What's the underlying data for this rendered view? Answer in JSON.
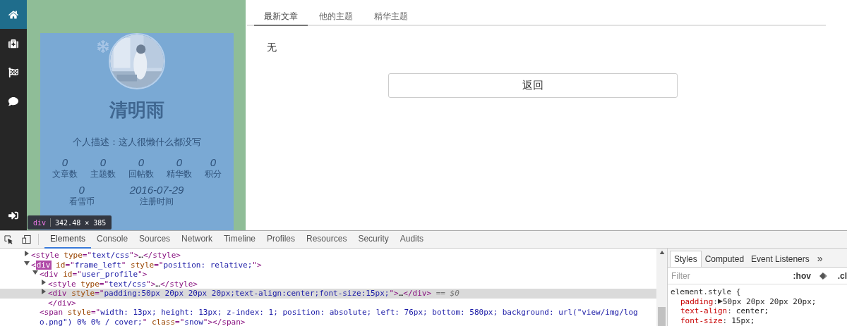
{
  "sidebar": {
    "items": [
      {
        "selected": true
      },
      {
        "selected": false
      },
      {
        "selected": false
      },
      {
        "selected": false
      }
    ]
  },
  "profile": {
    "name": "清明雨",
    "description": "个人描述：这人很懒什么都没写",
    "stats": [
      {
        "value": "0",
        "label": "文章数"
      },
      {
        "value": "0",
        "label": "主题数"
      },
      {
        "value": "0",
        "label": "回帖数"
      },
      {
        "value": "0",
        "label": "精华数"
      },
      {
        "value": "0",
        "label": "积分"
      }
    ],
    "stats_2": [
      {
        "value": "0",
        "label": "看雪币"
      },
      {
        "value": "2016-07-29",
        "label": "注册时间"
      }
    ]
  },
  "inspect_tooltip": {
    "tag": "div",
    "size": "342.48 × 385"
  },
  "main": {
    "tabs": [
      {
        "label": "最新文章",
        "selected": true
      },
      {
        "label": "他的主题",
        "selected": false
      },
      {
        "label": "精华主题",
        "selected": false
      }
    ],
    "empty_text": "无",
    "back_button": "返回"
  },
  "devtools": {
    "tabs": [
      {
        "label": "Elements",
        "selected": true
      },
      {
        "label": "Console",
        "selected": false
      },
      {
        "label": "Sources",
        "selected": false
      },
      {
        "label": "Network",
        "selected": false
      },
      {
        "label": "Timeline",
        "selected": false
      },
      {
        "label": "Profiles",
        "selected": false
      },
      {
        "label": "Resources",
        "selected": false
      },
      {
        "label": "Security",
        "selected": false
      },
      {
        "label": "Audits",
        "selected": false
      }
    ],
    "dom_tree": [
      {
        "expanded": false,
        "selected": false,
        "tokens": [
          {
            "kind": "tag",
            "text": "<style "
          },
          {
            "kind": "attr",
            "text": "type"
          },
          {
            "kind": "tag",
            "text": "=\""
          },
          {
            "kind": "value",
            "text": "text/css"
          },
          {
            "kind": "tag",
            "text": "\">"
          },
          {
            "kind": "plain",
            "text": "…"
          },
          {
            "kind": "tag",
            "text": "</style>"
          }
        ]
      },
      {
        "expanded": true,
        "selected": false,
        "tokens": [
          {
            "kind": "tag",
            "text": "<"
          },
          {
            "kind": "match",
            "text": "div"
          },
          {
            "kind": "attr",
            "text": " id"
          },
          {
            "kind": "tag",
            "text": "=\""
          },
          {
            "kind": "value",
            "text": "frame_left"
          },
          {
            "kind": "tag",
            "text": "\" "
          },
          {
            "kind": "attr",
            "text": "style"
          },
          {
            "kind": "tag",
            "text": "=\""
          },
          {
            "kind": "value",
            "text": "position: relative;"
          },
          {
            "kind": "tag",
            "text": "\">"
          }
        ],
        "children": [
          {
            "expanded": true,
            "selected": false,
            "tokens": [
              {
                "kind": "tag",
                "text": "<div "
              },
              {
                "kind": "attr",
                "text": "id"
              },
              {
                "kind": "tag",
                "text": "=\""
              },
              {
                "kind": "value",
                "text": "user_profile"
              },
              {
                "kind": "tag",
                "text": "\">"
              }
            ],
            "children": [
              {
                "expanded": false,
                "selected": false,
                "tokens": [
                  {
                    "kind": "tag",
                    "text": "<style "
                  },
                  {
                    "kind": "attr",
                    "text": "type"
                  },
                  {
                    "kind": "tag",
                    "text": "=\""
                  },
                  {
                    "kind": "value",
                    "text": "text/css"
                  },
                  {
                    "kind": "tag",
                    "text": "\">"
                  },
                  {
                    "kind": "plain",
                    "text": "…"
                  },
                  {
                    "kind": "tag",
                    "text": "</style>"
                  }
                ]
              },
              {
                "expanded": false,
                "selected": true,
                "tokens": [
                  {
                    "kind": "tag",
                    "text": "<div "
                  },
                  {
                    "kind": "attr",
                    "text": "style"
                  },
                  {
                    "kind": "tag",
                    "text": "=\""
                  },
                  {
                    "kind": "value",
                    "text": "padding:50px 20px 20px 20px;text-align:center;font-size:15px;"
                  },
                  {
                    "kind": "tag",
                    "text": "\">"
                  },
                  {
                    "kind": "plain",
                    "text": "…"
                  },
                  {
                    "kind": "tag",
                    "text": "</div>"
                  }
                ],
                "suffix": "== $0"
              },
              {
                "tokens": [
                  {
                    "kind": "tag",
                    "text": "</div>"
                  }
                ]
              }
            ]
          },
          {
            "tokens": [
              {
                "kind": "tag",
                "text": "<span "
              },
              {
                "kind": "attr",
                "text": "style"
              },
              {
                "kind": "tag",
                "text": "=\""
              },
              {
                "kind": "value",
                "text": "width: 13px; height: 13px; z-index: 1; position: absolute; left: 76px; bottom: 580px; background: url(\"view/img/logo.png\") 0% 0% / cover;"
              },
              {
                "kind": "tag",
                "text": "\" "
              },
              {
                "kind": "attr",
                "text": "class"
              },
              {
                "kind": "tag",
                "text": "=\""
              },
              {
                "kind": "value",
                "text": "snow"
              },
              {
                "kind": "tag",
                "text": "\"></span>"
              }
            ]
          }
        ]
      }
    ],
    "styles_tabs": [
      {
        "label": "Styles",
        "selected": true
      },
      {
        "label": "Computed",
        "selected": false
      },
      {
        "label": "Event Listeners",
        "selected": false
      }
    ],
    "styles_more": "»",
    "filter_placeholder": "Filter",
    "hov": ":hov",
    "cls": ".cl",
    "rule": {
      "selector": "element.style {",
      "separator": ":",
      "properties": [
        {
          "name": "padding",
          "value": "50px 20px 20px 20px;",
          "expandable": true
        },
        {
          "name": "text-align",
          "value": "center;",
          "expandable": false
        },
        {
          "name": "font-size",
          "value": "15px;",
          "expandable": false
        }
      ]
    }
  }
}
